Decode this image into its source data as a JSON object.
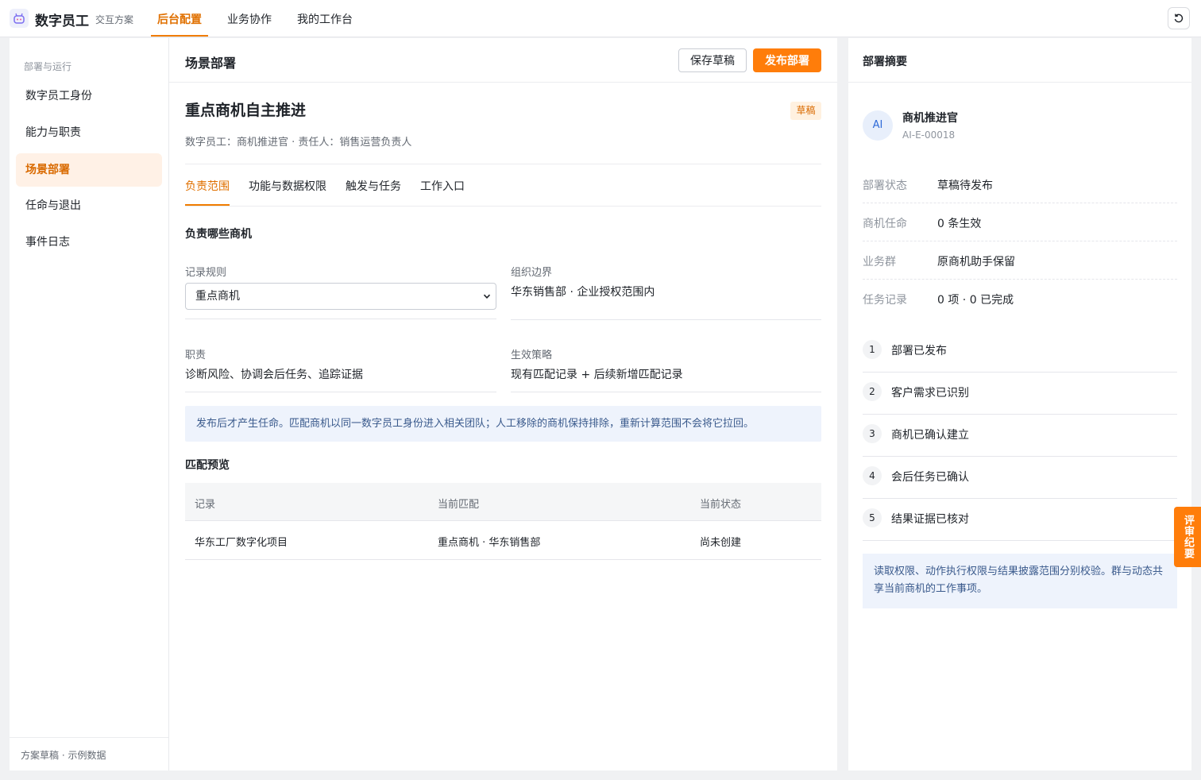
{
  "header": {
    "app_title": "数字员工",
    "app_subtitle": "交互方案",
    "nav": [
      "后台配置",
      "业务协作",
      "我的工作台"
    ],
    "active_nav": "后台配置",
    "accent": "#ff7d0a"
  },
  "sidebar": {
    "group_label": "部署与运行",
    "items": [
      {
        "label": "数字员工身份"
      },
      {
        "label": "能力与职责"
      },
      {
        "label": "场景部署"
      },
      {
        "label": "任命与退出"
      },
      {
        "label": "事件日志"
      }
    ],
    "active_item": "场景部署",
    "footer": "方案草稿 · 示例数据"
  },
  "main": {
    "title": "场景部署",
    "save_label": "保存草稿",
    "publish_label": "发布部署",
    "scene_title": "重点商机自主推进",
    "badge": "草稿",
    "meta": "数字员工：商机推进官 · 责任人：销售运营负责人",
    "tabs": [
      "负责范围",
      "功能与数据权限",
      "触发与任务",
      "工作入口"
    ],
    "active_tab": "负责范围",
    "section_title": "负责哪些商机",
    "fields": {
      "record_rule_label": "记录规则",
      "record_rule_value": "重点商机",
      "org_boundary_label": "组织边界",
      "org_boundary_value": "华东销售部 · 企业授权范围内",
      "duty_label": "职责",
      "duty_value": "诊断风险、协调会后任务、追踪证据",
      "policy_label": "生效策略",
      "policy_value": "现有匹配记录 + 后续新增匹配记录"
    },
    "notice": "发布后才产生任命。匹配商机以同一数字员工身份进入相关团队；人工移除的商机保持排除，重新计算范围不会将它拉回。",
    "preview_title": "匹配预览",
    "table": {
      "headers": [
        "记录",
        "当前匹配",
        "当前状态"
      ],
      "rows": [
        [
          "华东工厂数字化项目",
          "重点商机 · 华东销售部",
          "尚未创建"
        ]
      ]
    }
  },
  "summary": {
    "title": "部署摘要",
    "avatar": "AI",
    "name": "商机推进官",
    "id": "AI-E-00018",
    "info": [
      {
        "key": "部署状态",
        "value": "草稿待发布"
      },
      {
        "key": "商机任命",
        "value": "0 条生效"
      },
      {
        "key": "业务群",
        "value": "原商机助手保留"
      },
      {
        "key": "任务记录",
        "value": "0 项 · 0 已完成"
      }
    ],
    "steps": [
      {
        "num": "1",
        "label": "部署已发布"
      },
      {
        "num": "2",
        "label": "客户需求已识别"
      },
      {
        "num": "3",
        "label": "商机已确认建立"
      },
      {
        "num": "4",
        "label": "会后任务已确认"
      },
      {
        "num": "5",
        "label": "结果证据已核对"
      }
    ],
    "note": "读取权限、动作执行权限与结果披露范围分别校验。群与动态共享当前商机的工作事项。"
  },
  "review_tab": "评审纪要"
}
